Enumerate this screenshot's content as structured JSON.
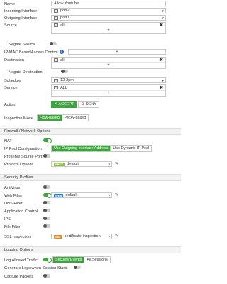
{
  "policy": {
    "name_label": "Name",
    "name_value": "Allow Youtube",
    "incoming_label": "Incoming Interface",
    "incoming_value": "port2",
    "outgoing_label": "Outgoing Interface",
    "outgoing_value": "port1",
    "source_label": "Source",
    "source_value": "all",
    "negate_source_label": "Negate Source",
    "ipmac_label": "IP/MAC Based Access Control",
    "destination_label": "Destination",
    "destination_value": "all",
    "negate_destination_label": "Negate Destination",
    "schedule_label": "Schedule",
    "schedule_value": "12-2pm",
    "service_label": "Service",
    "service_value": "ALL",
    "action_label": "Action",
    "accept_label": "ACCEPT",
    "deny_label": "DENY",
    "inspection_label": "Inspection Mode",
    "flow_based_label": "Flow-based",
    "proxy_based_label": "Proxy-based"
  },
  "firewall": {
    "section_title": "Firewall / Network Options",
    "nat_label": "NAT",
    "ip_pool_label": "IP Pool Configuration",
    "use_outgoing_label": "Use Outgoing Interface Address",
    "use_dynamic_label": "Use Dynamic IP Pool",
    "preserve_port_label": "Preserve Source Port",
    "protocol_options_label": "Protocol Options",
    "protocol_badge": "PROT",
    "protocol_value": "default"
  },
  "security": {
    "section_title": "Security Profiles",
    "antivirus_label": "AntiVirus",
    "webfilter_label": "Web Filter",
    "webfilter_badge": "WEB",
    "webfilter_value": "default",
    "dnsfilter_label": "DNS Filter",
    "appcontrol_label": "Application Control",
    "ips_label": "IPS",
    "filefilter_label": "File Filter",
    "ssl_label": "SSL Inspection",
    "ssl_badge": "SSL",
    "ssl_value": "certificate-inspection"
  },
  "logging": {
    "section_title": "Logging Options",
    "log_allowed_label": "Log Allowed Traffic",
    "security_events_label": "Security Events",
    "all_sessions_label": "All Sessions",
    "generate_logs_label": "Generate Logs when Session Starts",
    "capture_packets_label": "Capture Packets"
  },
  "icons": {
    "dropdown": "▾",
    "remove": "✖",
    "add": "+",
    "edit": "✎",
    "info": "i",
    "check": "✔",
    "ban": "⊘",
    "pencil": "pencil-icon"
  },
  "colors": {
    "accent_green": "#3da33d",
    "info_blue": "#2a6cb8",
    "web_badge": "#2b7bc1",
    "prot_badge": "#8cbf3f",
    "ssl_badge": "#d98c2b"
  }
}
